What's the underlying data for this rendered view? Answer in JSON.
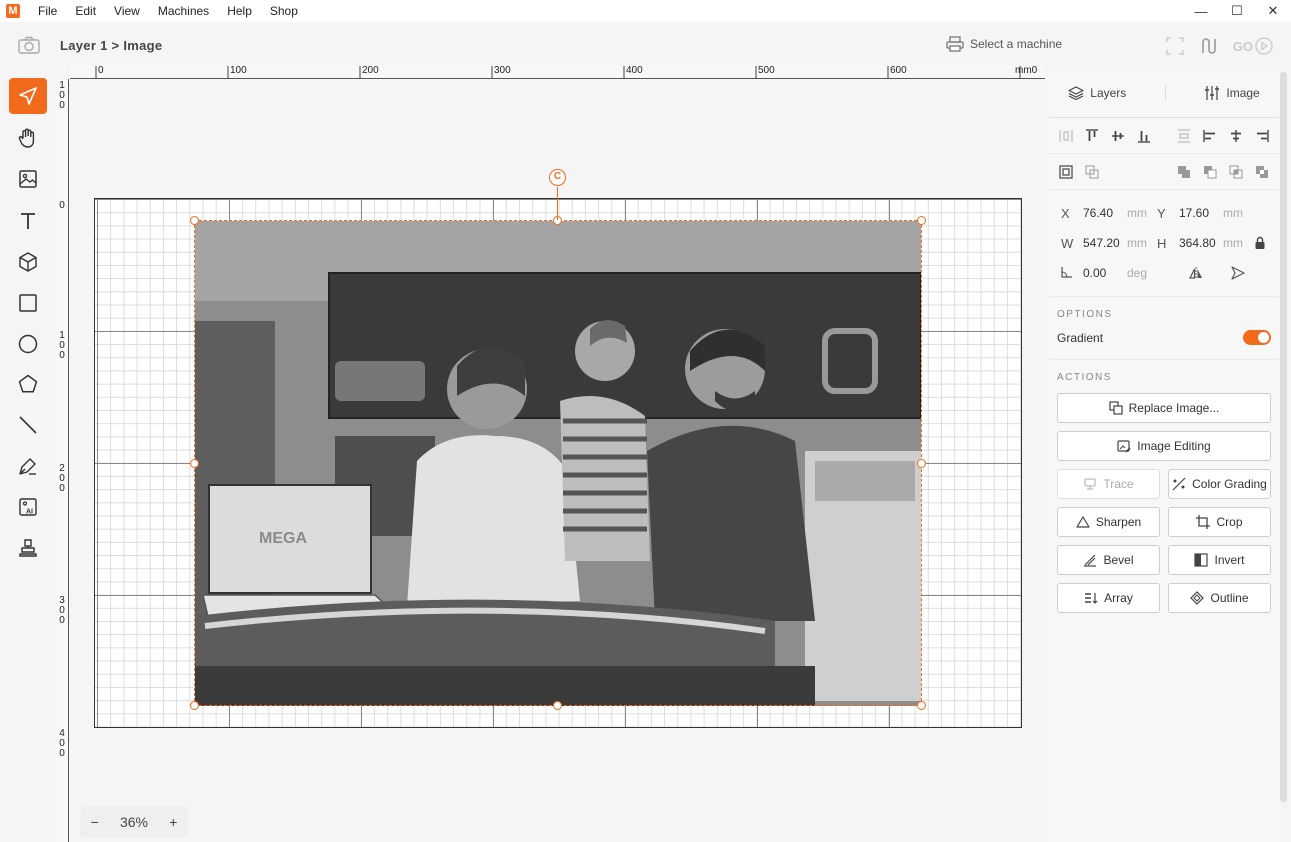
{
  "app": {
    "logo": "M"
  },
  "menu": [
    "File",
    "Edit",
    "View",
    "Machines",
    "Help",
    "Shop"
  ],
  "window_controls": {
    "minimize": "—",
    "maximize": "☐",
    "close": "✕"
  },
  "toolbar": {
    "breadcrumb": "Layer 1 > Image",
    "machine_label": "Select a machine",
    "go_label": "GO"
  },
  "rulers": {
    "top_labels": [
      "0",
      "100",
      "200",
      "300",
      "400",
      "500",
      "600",
      "mm0"
    ],
    "left_labels": [
      "1\n0\n0",
      "0",
      "1\n0\n0",
      "2\n0\n0",
      "3\n0\n0",
      "4\n0\n0"
    ]
  },
  "canvas": {
    "photo_text": "MEGA",
    "rotation_marker": "C"
  },
  "zoom": {
    "minus": "−",
    "value": "36%",
    "plus": "+"
  },
  "panel": {
    "tabs": {
      "layers": "Layers",
      "image": "Image"
    },
    "coords": {
      "x_label": "X",
      "x_value": "76.40",
      "x_unit": "mm",
      "y_label": "Y",
      "y_value": "17.60",
      "y_unit": "mm",
      "w_label": "W",
      "w_value": "547.20",
      "w_unit": "mm",
      "h_label": "H",
      "h_value": "364.80",
      "h_unit": "mm",
      "angle_value": "0.00",
      "angle_unit": "deg"
    },
    "options_title": "OPTIONS",
    "gradient_label": "Gradient",
    "gradient_on": true,
    "actions_title": "ACTIONS",
    "actions": {
      "replace": "Replace Image...",
      "editing": "Image Editing",
      "trace": "Trace",
      "color_grading": "Color Grading",
      "sharpen": "Sharpen",
      "crop": "Crop",
      "bevel": "Bevel",
      "invert": "Invert",
      "array": "Array",
      "outline": "Outline"
    }
  },
  "colors": {
    "accent": "#f26a1b"
  }
}
